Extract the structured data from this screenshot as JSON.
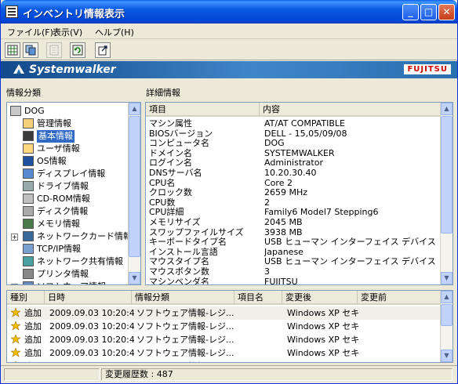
{
  "window": {
    "title": "インベントリ情報表示"
  },
  "menu": [
    {
      "label": "ファイル(F)"
    },
    {
      "label": "表示(V)"
    },
    {
      "label": "ヘルプ(H)"
    }
  ],
  "toolbar": {
    "icons": [
      "grid-icon",
      "copy-icon",
      "properties-icon",
      "refresh-icon",
      "export-icon"
    ]
  },
  "banner": {
    "product": "Systemwalker",
    "vendor": "FUJITSU"
  },
  "left_panel": {
    "title": "情報分類"
  },
  "right_panel": {
    "title": "詳細情報"
  },
  "tree": [
    {
      "label": "DOG",
      "icon": "computer-icon",
      "level": 0,
      "expander": ""
    },
    {
      "label": "管理情報",
      "icon": "users-icon",
      "level": 1,
      "expander": ""
    },
    {
      "label": "基本情報",
      "icon": "cpu-icon",
      "level": 1,
      "expander": "",
      "selected": true
    },
    {
      "label": "ユーザ情報",
      "icon": "user-icon",
      "level": 1,
      "expander": ""
    },
    {
      "label": "OS情報",
      "icon": "os-icon",
      "level": 1,
      "expander": ""
    },
    {
      "label": "ディスプレイ情報",
      "icon": "monitor-icon",
      "level": 1,
      "expander": ""
    },
    {
      "label": "ドライブ情報",
      "icon": "drive-icon",
      "level": 1,
      "expander": ""
    },
    {
      "label": "CD-ROM情報",
      "icon": "cdrom-icon",
      "level": 1,
      "expander": ""
    },
    {
      "label": "ディスク情報",
      "icon": "disk-icon",
      "level": 1,
      "expander": ""
    },
    {
      "label": "メモリ情報",
      "icon": "memory-icon",
      "level": 1,
      "expander": ""
    },
    {
      "label": "ネットワークカード情報",
      "icon": "network-card-icon",
      "level": 1,
      "expander": "+"
    },
    {
      "label": "TCP/IP情報",
      "icon": "tcpip-icon",
      "level": 1,
      "expander": ""
    },
    {
      "label": "ネットワーク共有情報",
      "icon": "network-share-icon",
      "level": 1,
      "expander": ""
    },
    {
      "label": "プリンタ情報",
      "icon": "printer-icon",
      "level": 1,
      "expander": ""
    },
    {
      "label": "ソフトウェア情報",
      "icon": "software-icon",
      "level": 1,
      "expander": "+"
    }
  ],
  "details": {
    "columns": [
      "項目",
      "内容"
    ],
    "rows": [
      [
        "マシン属性",
        "AT/AT COMPATIBLE"
      ],
      [
        "BIOSバージョン",
        "DELL   - 15,05/09/08"
      ],
      [
        "コンピュータ名",
        "DOG"
      ],
      [
        "ドメイン名",
        "SYSTEMWALKER"
      ],
      [
        "ログイン名",
        "Administrator"
      ],
      [
        "DNSサーバ名",
        "10.20.30.40"
      ],
      [
        "CPU名",
        "Core 2"
      ],
      [
        "クロック数",
        "2659 MHz"
      ],
      [
        "CPU数",
        "2"
      ],
      [
        "CPU詳細",
        "Family6 Model7 Stepping6"
      ],
      [
        "メモリサイズ",
        "2045 MB"
      ],
      [
        "スワップファイルサイズ",
        "3938 MB"
      ],
      [
        "キーボードタイプ名",
        "USB ヒューマン インターフェイス デバイス"
      ],
      [
        "インストール言語",
        "Japanese"
      ],
      [
        "マウスタイプ名",
        "USB ヒューマン インターフェイス デバイス"
      ],
      [
        "マウスボタン数",
        "3"
      ],
      [
        "マシンベンダ名",
        "FUJITSU"
      ]
    ]
  },
  "history": {
    "columns": [
      "種別",
      "日時",
      "情報分類",
      "項目名",
      "変更後",
      "変更前"
    ],
    "rows": [
      [
        "追加",
        "2009.09.03  10:20:42",
        "ソフトウェア情報-レジ...",
        "",
        "Windows XP セキ...",
        ""
      ],
      [
        "追加",
        "2009.09.03  10:20:42",
        "ソフトウェア情報-レジ...",
        "",
        "Windows XP セキ...",
        ""
      ],
      [
        "追加",
        "2009.09.03  10:20:42",
        "ソフトウェア情報-レジ...",
        "",
        "Windows XP セキ...",
        ""
      ],
      [
        "追加",
        "2009.09.03  10:20:42",
        "ソフトウェア情報-レジ...",
        "",
        "Windows XP セキ...",
        ""
      ],
      [
        "追加",
        "2009.09.03  10:20:42",
        "ソフトウェア情報-レジ...",
        "",
        "Windows XP セキ...",
        ""
      ]
    ]
  },
  "status": {
    "history_count": "変更履歴数 : 487"
  },
  "colors": {
    "title_bar": "#0a58e0",
    "selection": "#316ac5",
    "banner": "#2a6fb0",
    "warning": "#f0c000"
  }
}
